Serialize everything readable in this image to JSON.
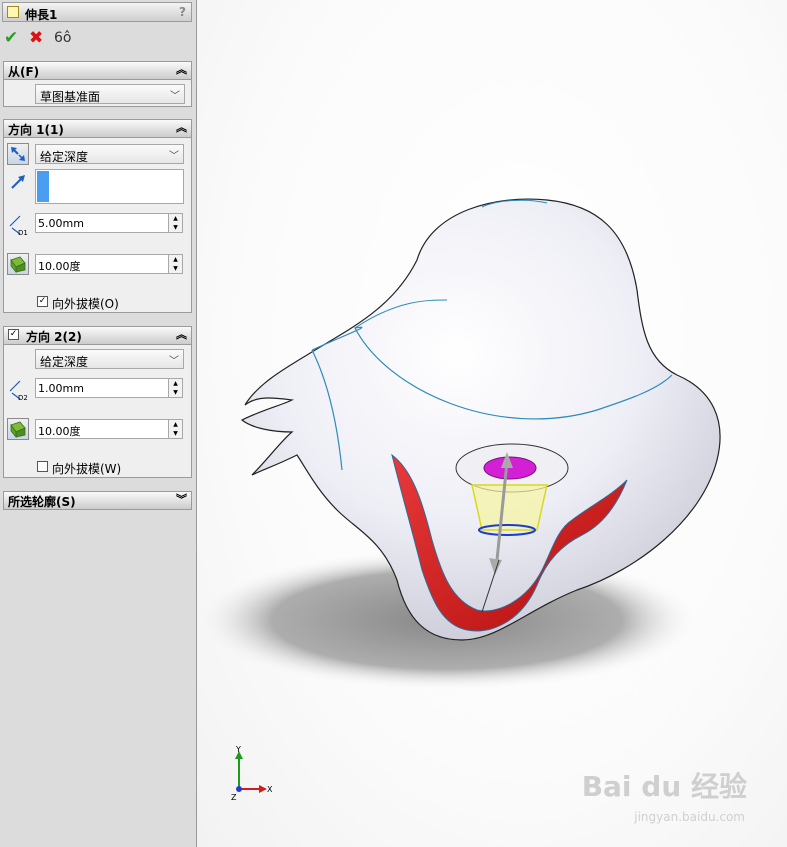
{
  "feature": {
    "title": "伸長1",
    "help": "?"
  },
  "actions": {
    "ok": "✔",
    "cancel": "✖",
    "preview": "6ô"
  },
  "from": {
    "title": "从(F)",
    "selected": "草图基准面"
  },
  "direction1": {
    "title": "方向 1(1)",
    "end_condition": "给定深度",
    "depth": "5.00mm",
    "draft_angle": "10.00度",
    "draft_outward_label": "向外拔模(O)",
    "draft_outward_checked": true
  },
  "direction2": {
    "title": "方向 2(2)",
    "enabled": true,
    "end_condition": "给定深度",
    "depth": "1.00mm",
    "draft_angle": "10.00度",
    "draft_outward_label": "向外拔模(W)",
    "draft_outward_checked": false
  },
  "selected_contours": {
    "title": "所选轮廓(S)"
  },
  "triad": {
    "x": "X",
    "y": "Y",
    "z": "Z"
  },
  "watermark": {
    "brand": "Bai du 经验",
    "url": "jingyan.baidu.com"
  }
}
